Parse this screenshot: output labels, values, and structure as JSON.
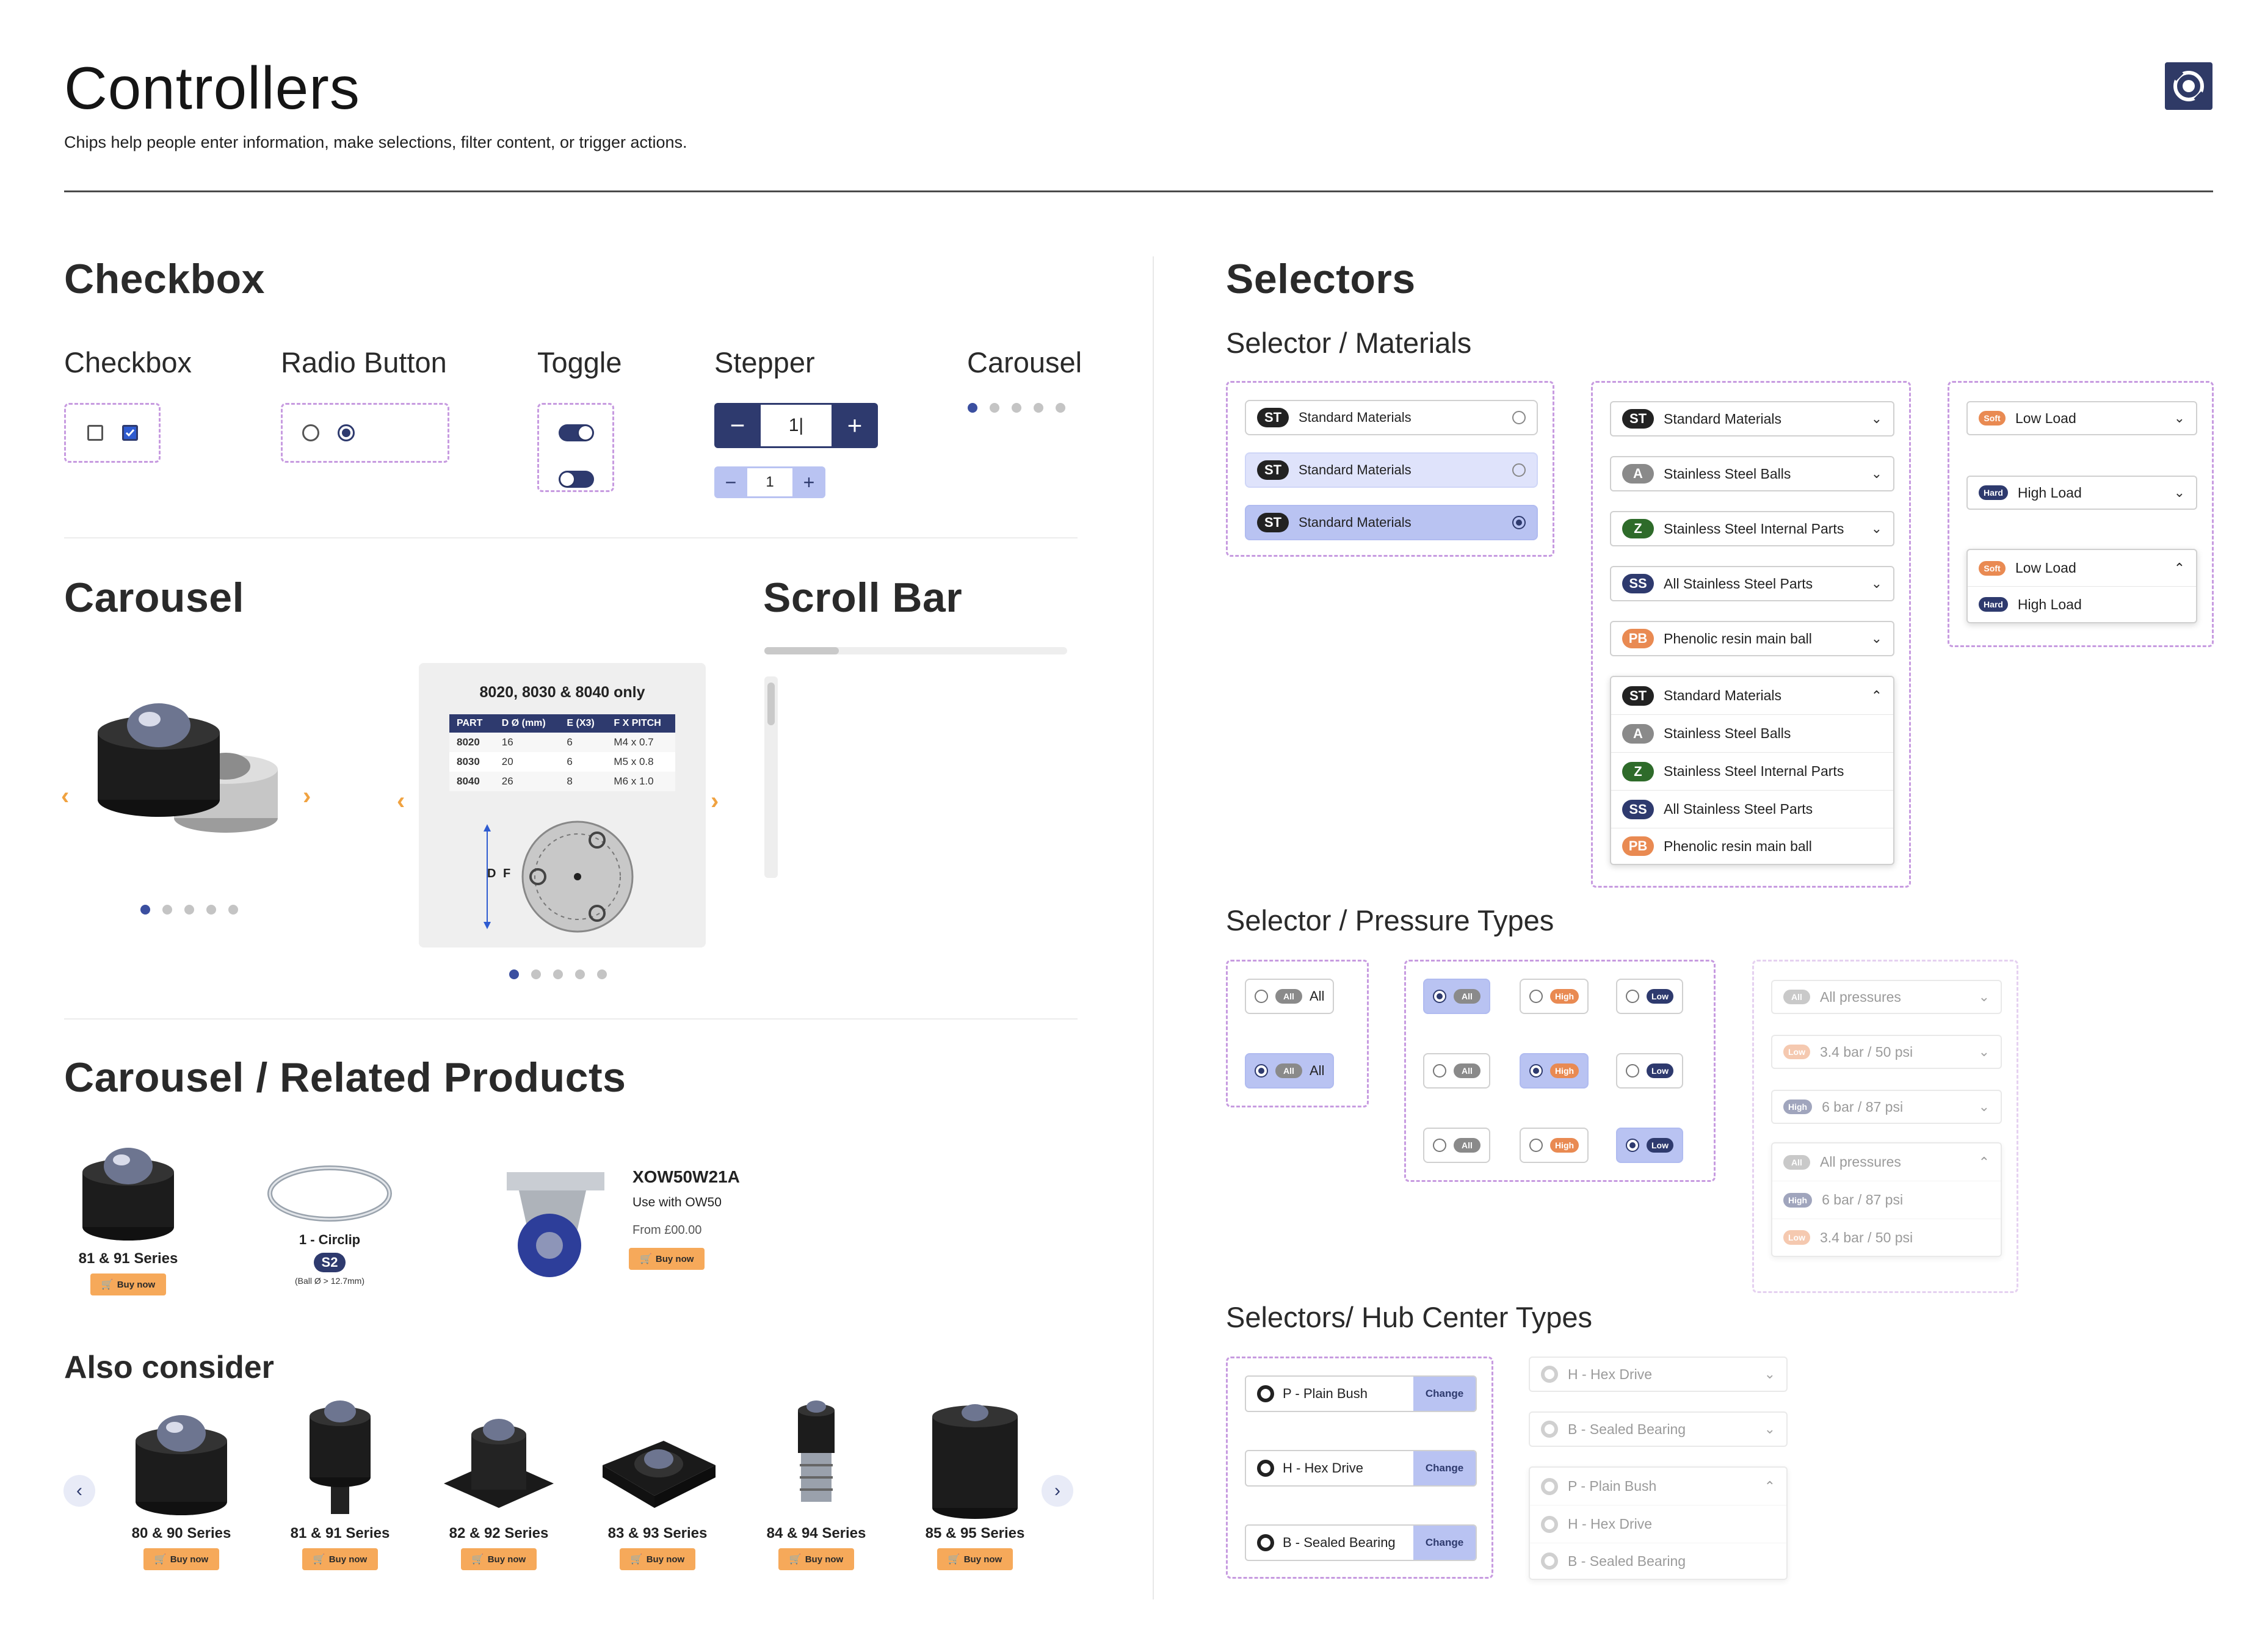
{
  "header": {
    "title": "Controllers",
    "subtitle": "Chips help people enter information, make selections, filter content, or trigger actions."
  },
  "checkbox_section": {
    "title": "Checkbox",
    "checkbox_label": "Checkbox",
    "radio_label": "Radio Button",
    "toggle_label": "Toggle",
    "stepper_label": "Stepper",
    "carousel_label": "Carousel",
    "stepper_large_value": "1|",
    "stepper_small_value": "1",
    "minus": "−",
    "plus": "+"
  },
  "carousel": {
    "title": "Carousel",
    "spec_title": "8020, 8030 & 8040 only",
    "spec_headers": [
      "PART",
      "D Ø (mm)",
      "E (X3)",
      "F X PITCH"
    ],
    "spec_rows": [
      [
        "8020",
        "16",
        "6",
        "M4 x 0.7"
      ],
      [
        "8030",
        "20",
        "6",
        "M5 x 0.8"
      ],
      [
        "8040",
        "26",
        "8",
        "M6 x 1.0"
      ]
    ],
    "diagram_labels": {
      "d": "D",
      "f": "F"
    },
    "prev": "‹",
    "next": "›"
  },
  "scrollbar": {
    "title": "Scroll Bar"
  },
  "related": {
    "title": "Carousel / Related Products",
    "items": [
      {
        "name": "81 & 91 Series",
        "buy": "Buy now"
      },
      {
        "name": "1 - Circlip",
        "badge": "S2",
        "note": "(Ball Ø > 12.7mm)"
      }
    ],
    "featured": {
      "name": "XOW50W21A",
      "use": "Use with OW50",
      "price": "From £00.00",
      "buy": "Buy now"
    }
  },
  "also_consider": {
    "title": "Also consider",
    "items": [
      {
        "name": "80 & 90 Series",
        "buy": "Buy now"
      },
      {
        "name": "81 & 91 Series",
        "buy": "Buy now"
      },
      {
        "name": "82 & 92 Series",
        "buy": "Buy now"
      },
      {
        "name": "83 & 93 Series",
        "buy": "Buy now"
      },
      {
        "name": "84 & 94 Series",
        "buy": "Buy now"
      },
      {
        "name": "85 & 95 Series",
        "buy": "Buy now"
      }
    ],
    "prev": "‹",
    "next": "›"
  },
  "selectors": {
    "title": "Selectors",
    "materials_title": "Selector / Materials",
    "material_radio": [
      {
        "chip": "ST",
        "label": "Standard Materials"
      },
      {
        "chip": "ST",
        "label": "Standard Materials"
      },
      {
        "chip": "ST",
        "label": "Standard Materials"
      }
    ],
    "material_dropdowns": [
      {
        "chip": "ST",
        "label": "Standard Materials"
      },
      {
        "chip": "A",
        "label": "Stainless Steel Balls"
      },
      {
        "chip": "Z",
        "label": "Stainless Steel Internal Parts"
      },
      {
        "chip": "SS",
        "label": "All Stainless Steel Parts"
      },
      {
        "chip": "PB",
        "label": "Phenolic resin main ball"
      }
    ],
    "material_list": [
      {
        "chip": "ST",
        "label": "Standard Materials"
      },
      {
        "chip": "A",
        "label": "Stainless Steel Balls"
      },
      {
        "chip": "Z",
        "label": "Stainless Steel Internal Parts"
      },
      {
        "chip": "SS",
        "label": "All Stainless Steel Parts"
      },
      {
        "chip": "PB",
        "label": "Phenolic resin main ball"
      }
    ],
    "load": {
      "soft_chip": "Soft",
      "soft_label": "Low Load",
      "hard_chip": "Hard",
      "hard_label": "High Load"
    },
    "pressure_title": "Selector / Pressure Types",
    "pressure": {
      "all_chip": "All",
      "all_label": "All",
      "high_chip": "High",
      "low_chip": "Low",
      "all_pressures": "All pressures",
      "low_value": "3.4 bar / 50 psi",
      "high_value": "6 bar / 87 psi"
    },
    "hub_title": "Selectors/ Hub Center Types",
    "hub": {
      "plain": "P - Plain Bush",
      "hex": "H - Hex Drive",
      "sealed": "B - Sealed Bearing",
      "change": "Change"
    }
  },
  "icons": {
    "chevron_down": "⌄",
    "chevron_up": "⌃",
    "cart": "🛒"
  },
  "colors": {
    "primary": "#2e3a6e",
    "accent_orange": "#f6a95a",
    "selected_light": "#b9c3f2",
    "dashed_border": "#c79be0"
  }
}
